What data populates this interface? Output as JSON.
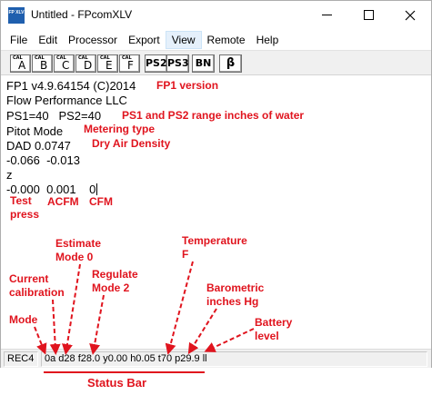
{
  "window": {
    "title": "Untitled - FPcomXLV",
    "app_icon_text": "FP XLV"
  },
  "menu": {
    "items": [
      "File",
      "Edit",
      "Processor",
      "Export",
      "View",
      "Remote",
      "Help"
    ],
    "active": "View"
  },
  "toolbar": {
    "cal_label": "CAL",
    "cal_buttons": [
      "A",
      "B",
      "C",
      "D",
      "E",
      "F"
    ],
    "ps2_label": "PS2",
    "ps3_label": "PS3",
    "bn_label": "BN",
    "beta_label": "β"
  },
  "content": {
    "lines": [
      "FP1 v4.9.64154 (C)2014",
      "Flow Performance LLC",
      "PS1=40   PS2=40",
      "Pitot Mode",
      "DAD 0.0747",
      "-0.066  -0.013",
      "z",
      "-0.000  0.001    0"
    ]
  },
  "annotations": {
    "fp1_version": "FP1 version",
    "ps_range": "PS1 and PS2 range inches of water",
    "metering_type": "Metering type",
    "dry_air_density": "Dry Air Density",
    "test_press": "Test\npress",
    "acfm": "ACFM",
    "cfm": "CFM",
    "estimate_mode": "Estimate\nMode 0",
    "temperature": "Temperature\nF",
    "current_calibration": "Current\ncalibration",
    "regulate_mode": "Regulate\nMode 2",
    "barometric": "Barometric\ninches Hg",
    "battery_level": "Battery\nlevel",
    "mode": "Mode",
    "status_bar": "Status Bar"
  },
  "statusbar": {
    "pane1": "REC4",
    "pane2": "0a d28 f28.0 y0.00 h0.05 t70 p29.9 ll"
  },
  "colors": {
    "annotation": "#e0141e",
    "toolbar_bg": "#f0f0f0",
    "menu_active_bg": "#e5f0fb"
  }
}
